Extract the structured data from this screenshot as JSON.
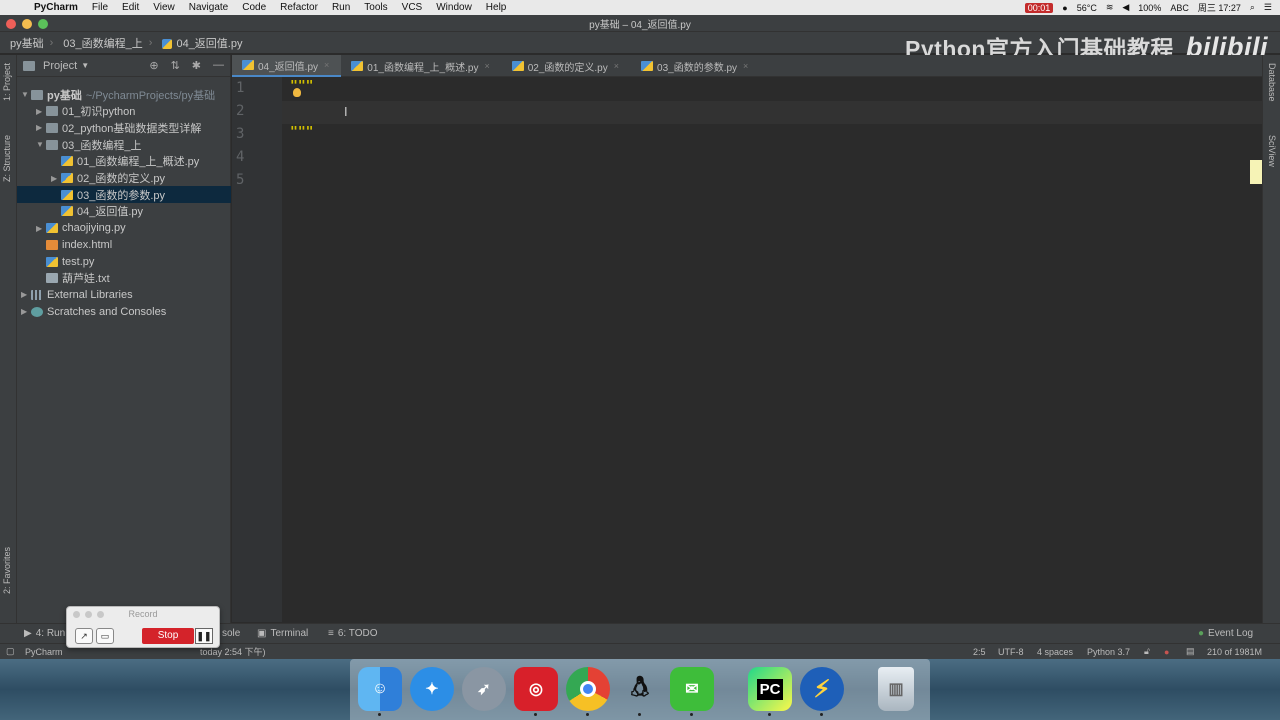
{
  "menubar": {
    "app": "PyCharm",
    "items": [
      "File",
      "Edit",
      "View",
      "Navigate",
      "Code",
      "Refactor",
      "Run",
      "Tools",
      "VCS",
      "Window",
      "Help"
    ],
    "status": {
      "record_time": "00:01",
      "temp": "56°C",
      "battery": "100%",
      "input": "ABC",
      "clock": "周三 17:27"
    }
  },
  "window_title": "py基础 – 04_返回值.py",
  "navbar": {
    "crumbs": [
      "py基础",
      "03_函数编程_上",
      "04_返回值.py"
    ],
    "watermark": "Python官方入门基础教程",
    "watermark_logo": "bilibili"
  },
  "project": {
    "header": "Project",
    "tree": [
      {
        "label": "py基础",
        "hint": "~/PycharmProjects/py基础",
        "icon": "folder",
        "arrow": "▼",
        "indent": 0,
        "bold": true
      },
      {
        "label": "01_初识python",
        "icon": "folder",
        "arrow": "▶",
        "indent": 1
      },
      {
        "label": "02_python基础数据类型详解",
        "icon": "folder",
        "arrow": "▶",
        "indent": 1
      },
      {
        "label": "03_函数编程_上",
        "icon": "folder",
        "arrow": "▼",
        "indent": 1
      },
      {
        "label": "01_函数编程_上_概述.py",
        "icon": "py",
        "arrow": "",
        "indent": 2
      },
      {
        "label": "02_函数的定义.py",
        "icon": "py",
        "arrow": "▶",
        "indent": 2
      },
      {
        "label": "03_函数的参数.py",
        "icon": "py",
        "arrow": "",
        "indent": 2,
        "selected": true
      },
      {
        "label": "04_返回值.py",
        "icon": "py",
        "arrow": "",
        "indent": 2
      },
      {
        "label": "chaojiying.py",
        "icon": "py",
        "arrow": "▶",
        "indent": 1
      },
      {
        "label": "index.html",
        "icon": "html",
        "arrow": "",
        "indent": 1
      },
      {
        "label": "test.py",
        "icon": "py",
        "arrow": "",
        "indent": 1
      },
      {
        "label": "葫芦娃.txt",
        "icon": "txt",
        "arrow": "",
        "indent": 1
      },
      {
        "label": "External Libraries",
        "icon": "lib",
        "arrow": "▶",
        "indent": 0
      },
      {
        "label": "Scratches and Consoles",
        "icon": "scratch",
        "arrow": "▶",
        "indent": 0
      }
    ]
  },
  "left_stripe": {
    "project": "1: Project",
    "structure": "Z: Structure",
    "favorites": "2: Favorites"
  },
  "right_stripe": {
    "database": "Database",
    "sciview": "SciView"
  },
  "tabs": [
    {
      "label": "04_返回值.py",
      "active": true
    },
    {
      "label": "01_函数编程_上_概述.py"
    },
    {
      "label": "02_函数的定义.py"
    },
    {
      "label": "03_函数的参数.py"
    }
  ],
  "editor": {
    "line_numbers": [
      "1",
      "2",
      "3",
      "4",
      "5"
    ],
    "lines": [
      "\"\"\"",
      "",
      "\"\"\"",
      "",
      ""
    ]
  },
  "toolstrip": {
    "run": "4: Run",
    "console": "sole",
    "terminal": "Terminal",
    "todo": "6: TODO",
    "event_log": "Event Log"
  },
  "statusbar": {
    "message": "PyCharm",
    "message_tail": "today 2:54 下午)",
    "position": "2:5",
    "encoding": "UTF-8",
    "indent": "4 spaces",
    "interpreter": "Python 3.7",
    "memory": "210 of 1981M"
  },
  "record": {
    "title": "Record",
    "stop": "Stop"
  },
  "dock": [
    "finder",
    "safari",
    "launchpad",
    "netease-music",
    "chrome",
    "qq",
    "wechat",
    "pycharm",
    "thunder",
    "trash"
  ]
}
